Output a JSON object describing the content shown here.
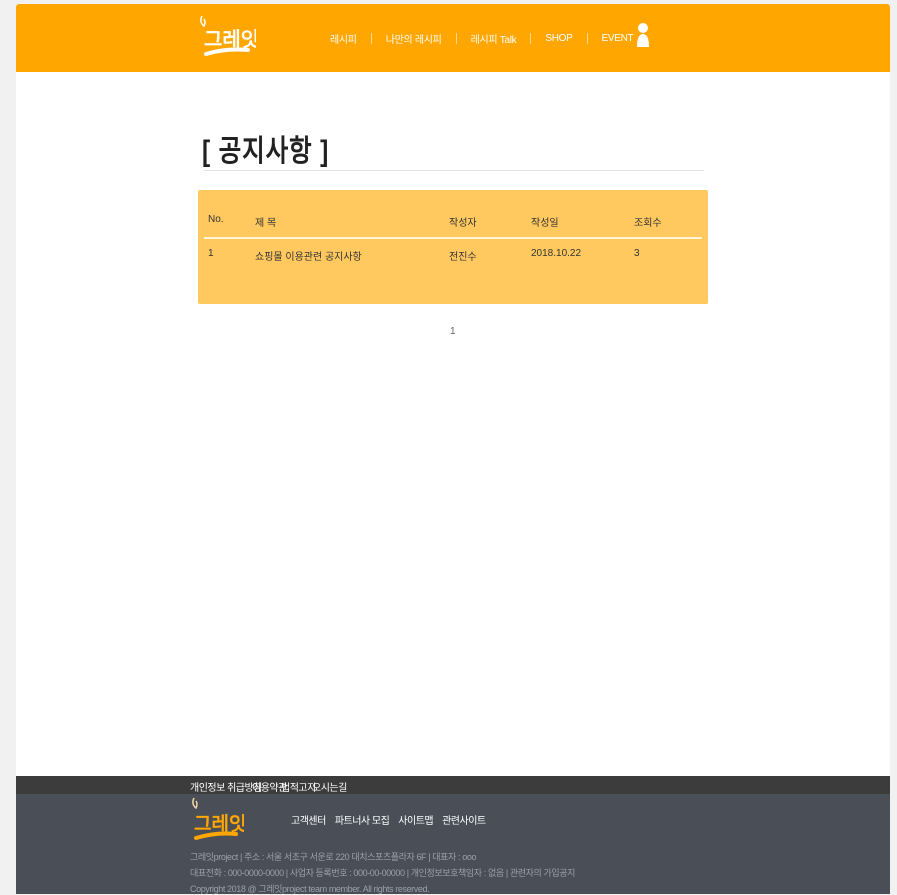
{
  "header": {
    "nav": [
      "레시피",
      "나만의 레시피",
      "레시피 Talk",
      "SHOP",
      "EVENT"
    ],
    "logo_text": "그레잇"
  },
  "page": {
    "title": "[ 공지사항 ]"
  },
  "board": {
    "columns": {
      "no": "No.",
      "subject": "제 목",
      "writer": "작성자",
      "date": "작성일",
      "views": "조회수"
    },
    "rows": [
      {
        "no": "1",
        "subject": "쇼핑몰 이용관련 공지사항",
        "writer": "전진수",
        "date": "2018.10.22",
        "views": "3"
      }
    ]
  },
  "pagination": {
    "current": "1"
  },
  "footer": {
    "links": [
      "개인정보 취급방침",
      "이용약관",
      "법적고지",
      "오시는길"
    ],
    "nav": [
      "고객센터",
      "파트너사 모집",
      "사이트맵",
      "관련사이트"
    ],
    "info_line1": "그레잇project | 주소 : 서울 서초구 서운로 220 대치스포츠플라자 6F | 대표자 : ooo",
    "info_line2": "대표전화 : 000-0000-0000 | 사업자 등록번호 : 000-00-00000 | 개인정보보호책임자 : 없음 | 관련자의 가입공지",
    "copyright": "Copyright 2018 @ 그레잇project team member. All rights reserved."
  },
  "colors": {
    "header": "#ffa600",
    "board": "#ffc95f",
    "footer": "#4a4f57",
    "footer_top": "#3c3c3c"
  }
}
